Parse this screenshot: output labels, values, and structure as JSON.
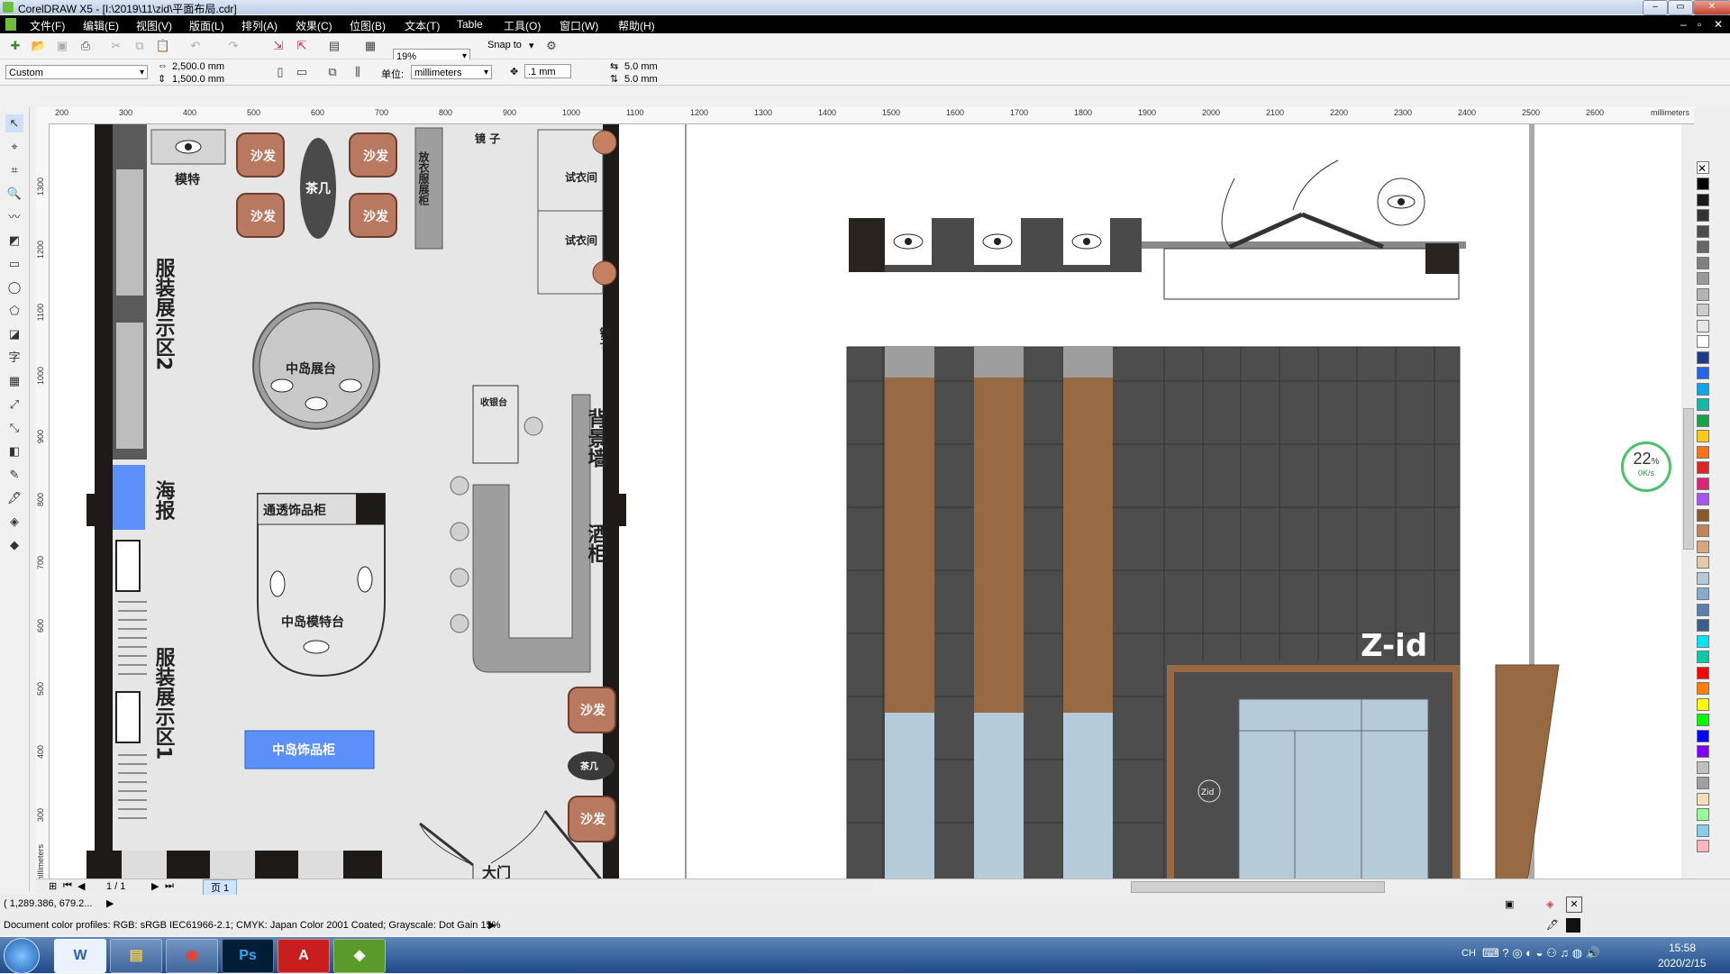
{
  "window": {
    "title": "CorelDRAW X5 - [I:\\2019\\11\\zid\\平面布局.cdr]"
  },
  "menu": [
    "文件(F)",
    "编辑(E)",
    "视图(V)",
    "版面(L)",
    "排列(A)",
    "效果(C)",
    "位图(B)",
    "文本(T)",
    "Table",
    "工具(O)",
    "窗口(W)",
    "帮助(H)"
  ],
  "toolbar": {
    "zoom": "19%",
    "snap_to": "Snap to"
  },
  "property_bar": {
    "page_preset": "Custom",
    "width": "2,500.0 mm",
    "height": "1,500.0 mm",
    "units_label": "单位:",
    "units": "millimeters",
    "nudge": ".1 mm",
    "dup_x": "5.0 mm",
    "dup_y": "5.0 mm"
  },
  "ruler": {
    "h_ticks": [
      "200",
      "300",
      "400",
      "500",
      "600",
      "700",
      "800",
      "900",
      "1000",
      "1100",
      "1200",
      "1300",
      "1400",
      "1500",
      "1600",
      "1700",
      "1800",
      "1900",
      "2000",
      "2100",
      "2200",
      "2300",
      "2400",
      "2500",
      "2600"
    ],
    "h_unit": "millimeters",
    "v_ticks": [
      "1300",
      "1200",
      "1100",
      "1000",
      "900",
      "800",
      "700",
      "600",
      "500",
      "400",
      "300"
    ],
    "v_unit": "millimeters"
  },
  "plan_labels": {
    "model": "模特",
    "sofa": "沙发",
    "tea_table": "茶几",
    "tea_table_small": "茶几",
    "wardrobe": "放衣服展柜",
    "mirror": "镜 子",
    "mirror_vertical": "镜子",
    "fitting_room": "试衣间",
    "display_area_2": "服装展示区2",
    "display_area_1": "服装展示区1",
    "island_stand": "中岛展台",
    "cashier": "收银台",
    "background_wall": "背景墙",
    "wine_cabinet": "酒柜",
    "poster": "海报",
    "transparent_cabinet": "通透饰品柜",
    "island_model": "中岛模特台",
    "island_cabinet": "中岛饰品柜",
    "main_door": "大门"
  },
  "elevation": {
    "logo": "Z-id",
    "badge": "Zid"
  },
  "network_widget": {
    "percent": "22",
    "speed": "0K/s"
  },
  "page_nav": {
    "count": "1 / 1",
    "tab": "页 1"
  },
  "status": {
    "coords": "( 1,289.386, 679.2... ",
    "color_profiles": "Document color profiles: RGB: sRGB IEC61966-2.1; CMYK: Japan Color 2001 Coated; Grayscale: Dot Gain 15%"
  },
  "taskbar": {
    "lang": "CH",
    "time": "15:58",
    "date": "2020/2/15",
    "apps": [
      "word",
      "explorer",
      "chrome",
      "photoshop",
      "autocad",
      "coreldraw"
    ]
  },
  "palette": [
    "#000000",
    "#1a1a1a",
    "#333333",
    "#4d4d4d",
    "#666666",
    "#808080",
    "#999999",
    "#b3b3b3",
    "#cccccc",
    "#e6e6e6",
    "#ffffff",
    "#1e3a8a",
    "#2563eb",
    "#0ea5e9",
    "#14b8a6",
    "#16a34a",
    "#facc15",
    "#f97316",
    "#dc2626",
    "#db2777",
    "#a855f7",
    "#8b5a2b",
    "#c08457",
    "#d6a77a",
    "#e5c9a8",
    "#b6c9d8",
    "#88aacc",
    "#5a7fa8",
    "#3b5f8a",
    "#00e5ff",
    "#00ccaa",
    "#ff0000",
    "#ff7f00",
    "#ffff00",
    "#00ff00",
    "#0000ff",
    "#7f00ff",
    "#c0c0c0",
    "#a0a0a0",
    "#f5deb3",
    "#98fb98",
    "#87ceeb",
    "#ffb6c1"
  ]
}
